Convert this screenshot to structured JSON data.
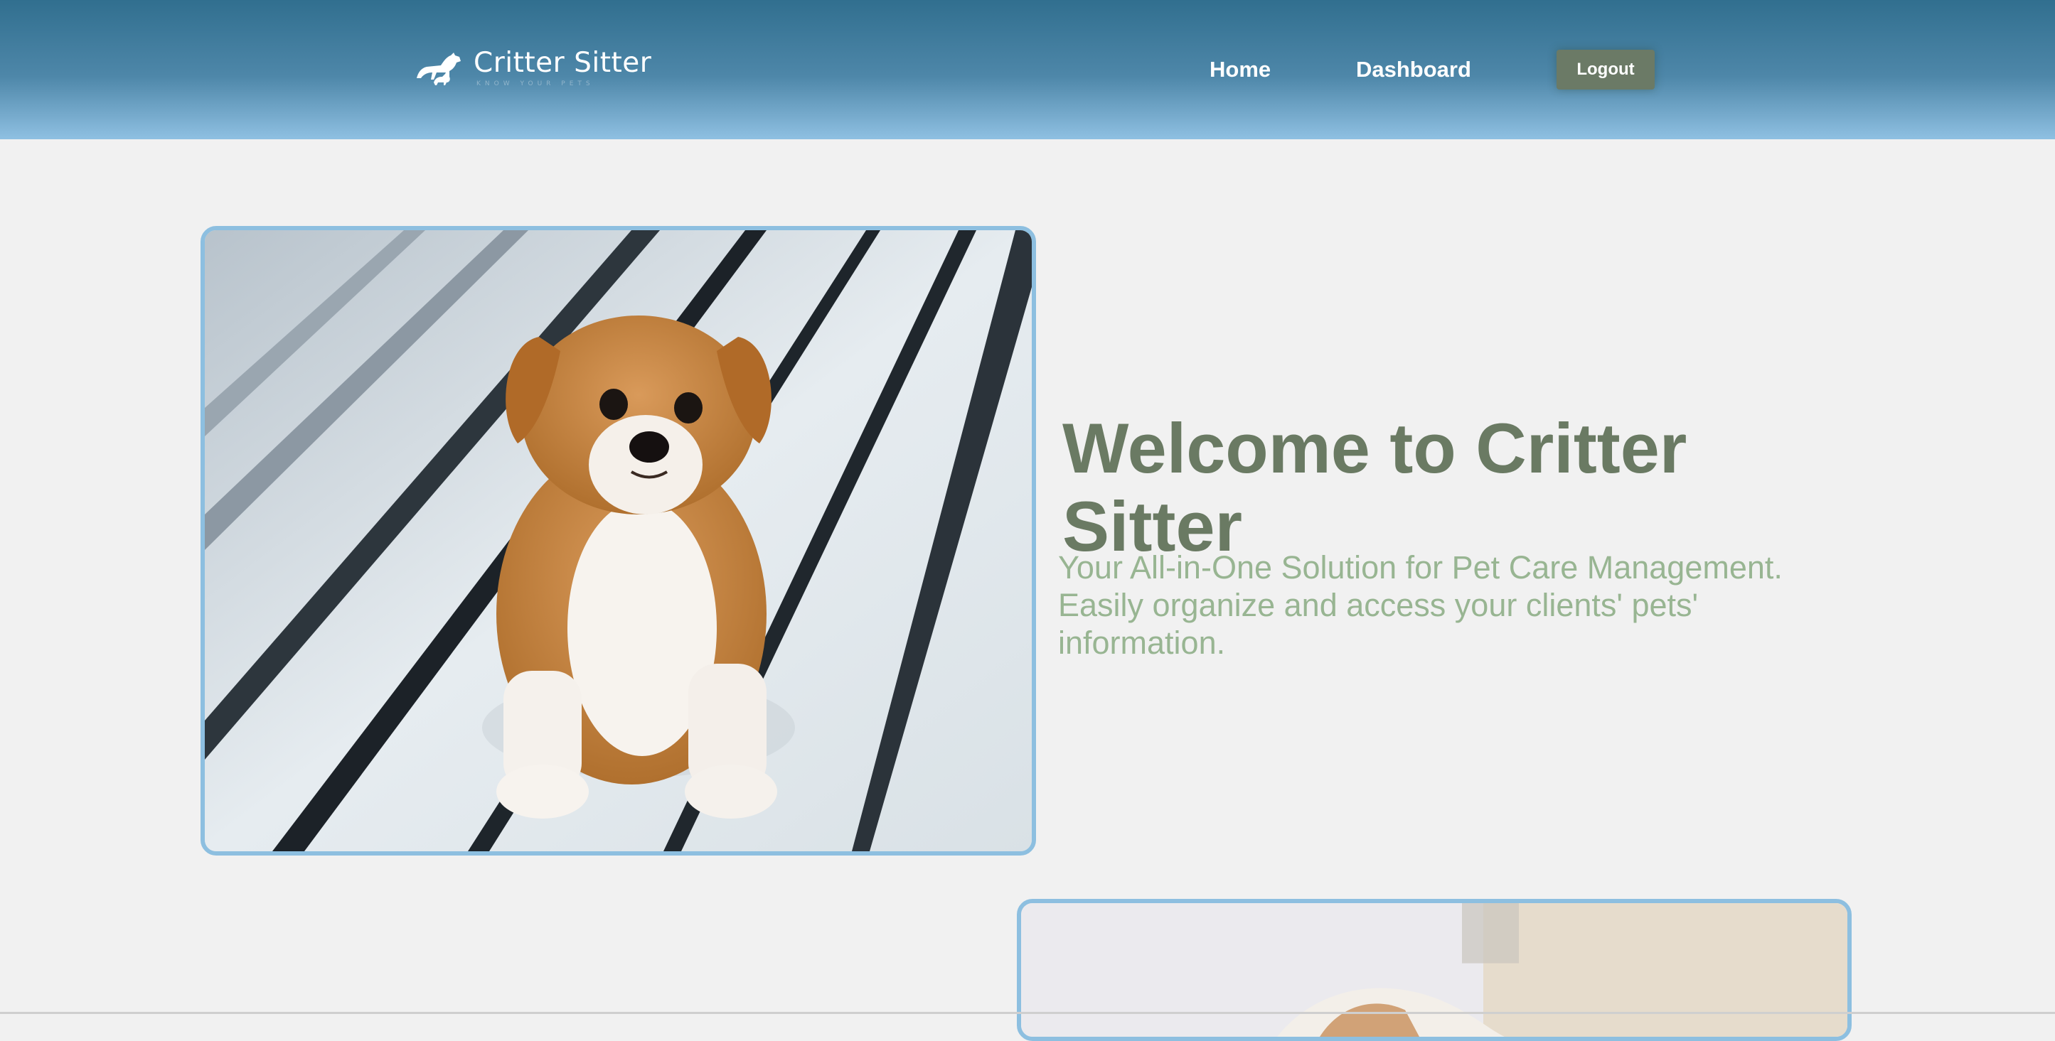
{
  "header": {
    "logo_title": "Critter Sitter",
    "logo_tagline": "KNOW YOUR PETS",
    "nav": [
      {
        "label": "Home"
      },
      {
        "label": "Dashboard"
      }
    ],
    "logout_label": "Logout"
  },
  "hero": {
    "heading": "Welcome to Critter Sitter",
    "subheading": "Your All-in-One Solution for Pet Care Management. Easily organize and access your clients' pets' information."
  },
  "colors": {
    "header_top": "#316f8f",
    "header_bottom": "#8fc0e2",
    "accent_green": "#6b7a66",
    "subtext_green": "#98b592",
    "image_border": "#8dbfe0",
    "page_bg": "#f1f1f1"
  }
}
